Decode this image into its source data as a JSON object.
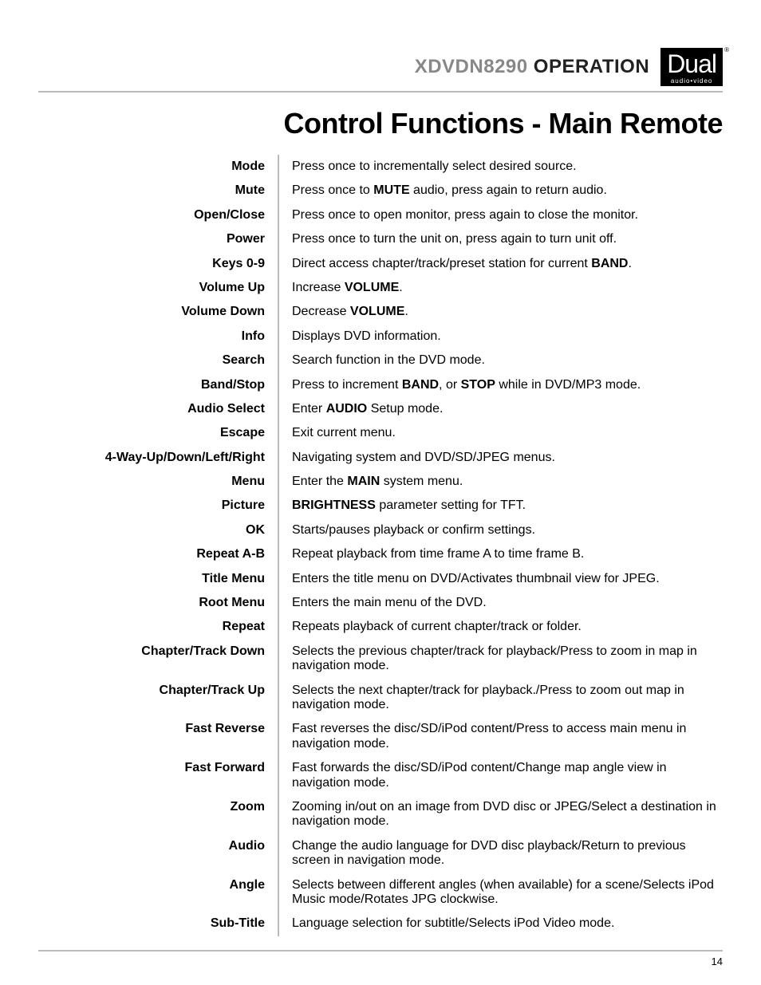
{
  "header": {
    "model": "XDVDN8290",
    "operation": "OPERATION",
    "logo_main": "Dual",
    "logo_sub": "audio•video",
    "logo_reg": "®"
  },
  "section_title": "Control Functions - Main Remote",
  "functions": [
    {
      "label": "Mode",
      "desc": "Press once to incrementally select desired source."
    },
    {
      "label": "Mute",
      "desc": "Press once to <b>MUTE</b> audio, press again to return audio."
    },
    {
      "label": "Open/Close",
      "desc": "Press once to open monitor, press again to close the monitor."
    },
    {
      "label": "Power",
      "desc": "Press once to turn the unit on, press again to turn unit off."
    },
    {
      "label": "Keys 0-9",
      "desc": "Direct access chapter/track/preset station for current <b>BAND</b>."
    },
    {
      "label": "Volume Up",
      "desc": "Increase <b>VOLUME</b>."
    },
    {
      "label": "Volume Down",
      "desc": "Decrease <b>VOLUME</b>."
    },
    {
      "label": "Info",
      "desc": "Displays DVD information."
    },
    {
      "label": "Search",
      "desc": "Search function in the DVD mode."
    },
    {
      "label": "Band/Stop",
      "desc": "Press to increment <b>BAND</b>, or <b>STOP</b> while in DVD/MP3 mode."
    },
    {
      "label": "Audio Select",
      "desc": "Enter <b>AUDIO</b> Setup mode."
    },
    {
      "label": "Escape",
      "desc": "Exit current menu."
    },
    {
      "label": "4-Way-Up/Down/Left/Right",
      "desc": "Navigating system and DVD/SD/JPEG menus."
    },
    {
      "label": "Menu",
      "desc": "Enter the <b>MAIN</b> system menu."
    },
    {
      "label": "Picture",
      "desc": "<b>BRIGHTNESS</b> parameter setting for TFT."
    },
    {
      "label": "OK",
      "desc": "Starts/pauses playback or confirm settings."
    },
    {
      "label": "Repeat A-B",
      "desc": "Repeat playback from time frame A to time frame B."
    },
    {
      "label": "Title Menu",
      "desc": "Enters the title menu on DVD/Activates thumbnail view for JPEG."
    },
    {
      "label": "Root Menu",
      "desc": "Enters the main menu of the DVD."
    },
    {
      "label": "Repeat",
      "desc": "Repeats playback of current chapter/track or folder."
    },
    {
      "label": "Chapter/Track Down",
      "desc": "Selects the previous chapter/track for playback/Press to zoom in map in navigation mode."
    },
    {
      "label": "Chapter/Track Up",
      "desc": "Selects the next chapter/track for playback./Press to zoom out map in navigation mode."
    },
    {
      "label": "Fast Reverse",
      "desc": "Fast reverses the disc/SD/iPod content/Press to access main menu in navigation mode."
    },
    {
      "label": "Fast Forward",
      "desc": "Fast forwards the disc/SD/iPod content/Change map angle view in navigation mode."
    },
    {
      "label": "Zoom",
      "desc": "Zooming in/out on an image from DVD disc or JPEG/Select a destination in navigation mode."
    },
    {
      "label": "Audio",
      "desc": "Change the audio language for DVD disc playback/Return to previous screen in navigation mode."
    },
    {
      "label": "Angle",
      "desc": "Selects between different angles (when available) for a scene/Selects iPod Music mode/Rotates JPG clockwise."
    },
    {
      "label": "Sub-Title",
      "desc": "Language selection for subtitle/Selects iPod Video mode."
    }
  ],
  "page_number": "14"
}
